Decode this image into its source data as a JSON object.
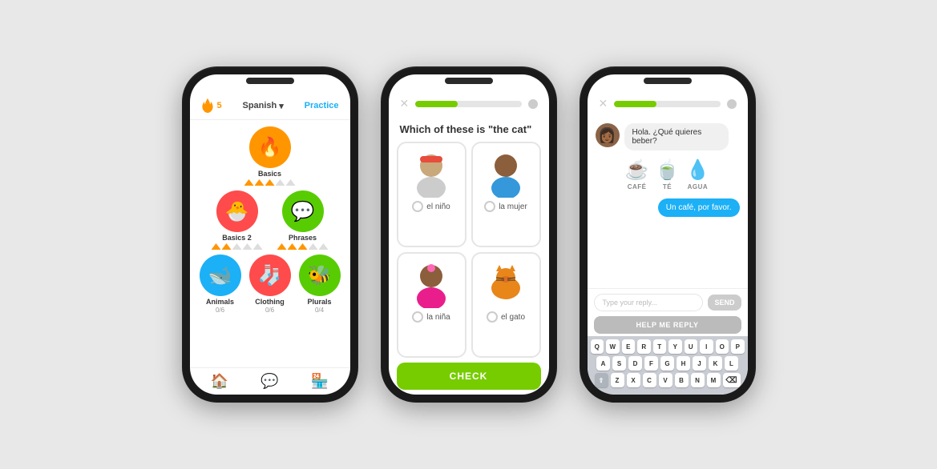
{
  "phones": {
    "phone1": {
      "streak": "5",
      "language": "Spanish",
      "practice": "Practice",
      "lessons": [
        {
          "name": "Basics",
          "icon": "🔥",
          "color": "#ff9600",
          "stars": 3,
          "total_stars": 5
        },
        {
          "name": "Basics 2",
          "icon": "🐣",
          "color": "#ff4b4b",
          "sublabel": ""
        },
        {
          "name": "Phrases",
          "icon": "💬",
          "color": "#58cc02",
          "sublabel": ""
        },
        {
          "name": "Animals",
          "icon": "🐋",
          "color": "#1cb0f6",
          "sublabel": "0/6"
        },
        {
          "name": "Clothing",
          "icon": "🧦",
          "color": "#ff4b4b",
          "sublabel": "0/6"
        },
        {
          "name": "Plurals",
          "icon": "🐝",
          "color": "#58cc02",
          "sublabel": "0/4"
        }
      ]
    },
    "phone2": {
      "question": "Which of these is \"the cat\"",
      "progress": 40,
      "options": [
        {
          "text": "el niño",
          "emoji": "👦"
        },
        {
          "text": "la mujer",
          "emoji": "👩"
        },
        {
          "text": "la niña",
          "emoji": "👧"
        },
        {
          "text": "el gato",
          "emoji": "🐈"
        }
      ],
      "check_label": "CHECK"
    },
    "phone3": {
      "progress": 40,
      "bot_message": "Hola. ¿Qué quieres beber?",
      "items": [
        {
          "icon": "☕",
          "label": "CAFÉ"
        },
        {
          "icon": "🍵",
          "label": "TÉ"
        },
        {
          "icon": "💧",
          "label": "AGUA"
        }
      ],
      "user_message": "Un café, por favor.",
      "input_placeholder": "Type your reply...",
      "send_label": "SEND",
      "help_label": "HELP ME REPLY",
      "keyboard": {
        "row1": [
          "Q",
          "W",
          "E",
          "R",
          "T",
          "Y",
          "U",
          "I",
          "O",
          "P"
        ],
        "row2": [
          "A",
          "S",
          "D",
          "F",
          "G",
          "H",
          "J",
          "K",
          "L"
        ],
        "row3": [
          "Z",
          "X",
          "C",
          "V",
          "B",
          "N",
          "M"
        ]
      }
    }
  }
}
